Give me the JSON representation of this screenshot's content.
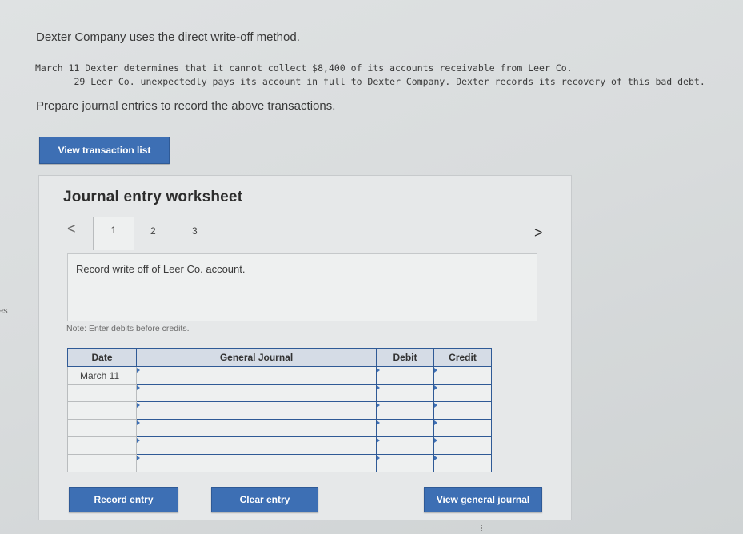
{
  "problem": {
    "intro": "Dexter Company uses the direct write-off method.",
    "line1": "March 11 Dexter determines that it cannot collect $8,400 of its accounts receivable from Leer Co.",
    "line2": "       29 Leer Co. unexpectedly pays its account in full to Dexter Company. Dexter records its recovery of this bad debt.",
    "prepare": "Prepare journal entries to record the above transactions."
  },
  "side_text": "es",
  "view_transaction_list_label": "View transaction list",
  "worksheet": {
    "title": "Journal entry worksheet",
    "prev_icon": "<",
    "next_icon": ">",
    "tabs": [
      "1",
      "2",
      "3"
    ],
    "active_tab": "1",
    "instruction": "Record write off of Leer Co. account.",
    "note": "Note: Enter debits before credits."
  },
  "journal": {
    "headers": {
      "date": "Date",
      "general_journal": "General Journal",
      "debit": "Debit",
      "credit": "Credit"
    },
    "rows": [
      {
        "date": "March 11",
        "account": "",
        "debit": "",
        "credit": ""
      },
      {
        "date": "",
        "account": "",
        "debit": "",
        "credit": ""
      },
      {
        "date": "",
        "account": "",
        "debit": "",
        "credit": ""
      },
      {
        "date": "",
        "account": "",
        "debit": "",
        "credit": ""
      },
      {
        "date": "",
        "account": "",
        "debit": "",
        "credit": ""
      },
      {
        "date": "",
        "account": "",
        "debit": "",
        "credit": ""
      }
    ]
  },
  "buttons": {
    "record_entry": "Record entry",
    "clear_entry": "Clear entry",
    "view_general_journal": "View general journal"
  },
  "colors": {
    "accent": "#3d6fb4",
    "header_bg": "#d5dce6",
    "border_blue": "#2f5a96"
  }
}
